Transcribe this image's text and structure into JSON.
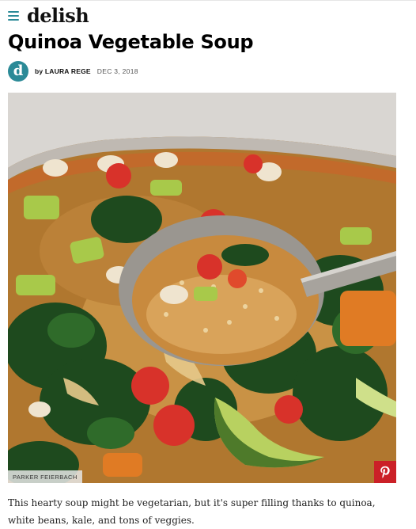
{
  "header": {
    "logo_text": "delish",
    "menu_icon": "hamburger-menu-icon",
    "accent_color": "#2b8a97"
  },
  "article": {
    "title": "Quinoa Vegetable Soup",
    "avatar_letter": "d",
    "by_prefix": "by",
    "author": "LAURA REGE",
    "date": "DEC 3, 2018",
    "photo_credit": "PARKER FEIERBACH",
    "pin_icon": "pinterest-icon",
    "pin_color": "#cb2027",
    "intro": "This hearty soup might be vegetarian, but it's super filling thanks to quinoa, white beans, kale, and tons of veggies."
  }
}
